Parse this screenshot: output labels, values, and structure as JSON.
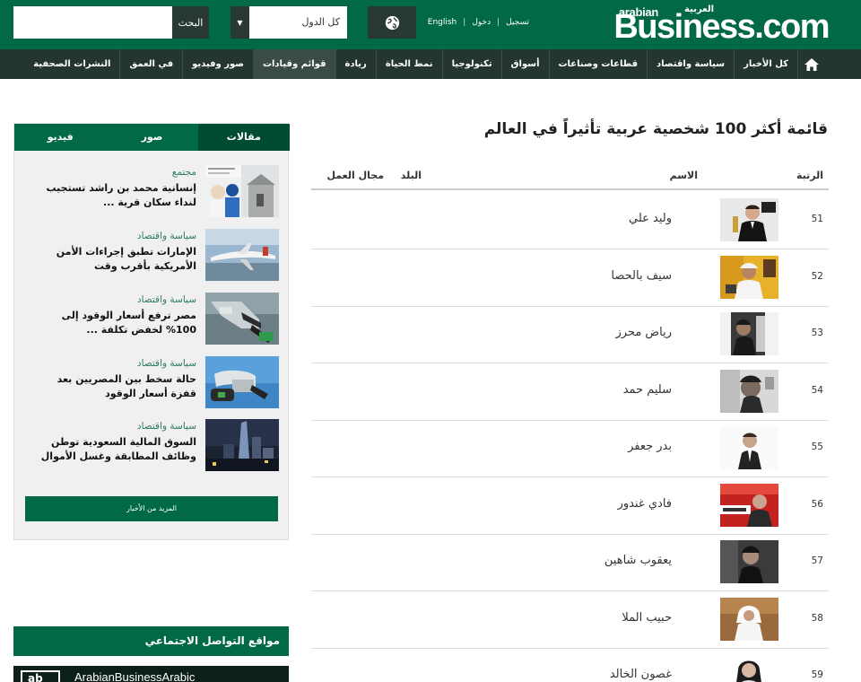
{
  "header": {
    "logo_latin": "arabian",
    "logo_arabic": "العربية",
    "logo_main": "Business.com",
    "links": {
      "english": "English",
      "login": "دخول",
      "register": "تسجيل"
    },
    "country_select": "كل الدول",
    "search_button": "البحث",
    "search_placeholder": ""
  },
  "nav": {
    "items": [
      "كل الأخبار",
      "سياسة واقتصاد",
      "قطاعات وصناعات",
      "أسواق",
      "تكنولوجيا",
      "نمط الحياة",
      "ريادة",
      "قوائم وقيادات",
      "صور وفيديو",
      "في العمق",
      "النشرات الصحفية"
    ]
  },
  "sidebar": {
    "tabs": [
      "مقالات",
      "صور",
      "فيديو"
    ],
    "news": [
      {
        "category": "مجتمع",
        "title": "إنسانية محمد بن راشد تستجيب لنداء سكان قرية ..."
      },
      {
        "category": "سياسة واقتصاد",
        "title": "الإمارات تطبق إجراءات الأمن الأمريكية بأقرب وقت"
      },
      {
        "category": "سياسة واقتصاد",
        "title": "مصر ترفع أسعار الوقود إلى 100% لخفض تكلفة ..."
      },
      {
        "category": "سياسة واقتصاد",
        "title": "حالة سخط بين المصريين بعد قفزة أسعار الوقود"
      },
      {
        "category": "سياسة واقتصاد",
        "title": "السوق المالية السعودية توطن وظائف المطابقة وغسل الأموال"
      }
    ],
    "more_button": "المزيد من الأخبار"
  },
  "social": {
    "heading": "مواقع التواصل الاجتماعي",
    "box": "ab",
    "account": "ArabianBusinessArabic"
  },
  "main": {
    "title": "قائمة أكثر 100 شخصية عربية تأثيراً في العالم",
    "columns": {
      "rank": "الرتبة",
      "name": "الاسم",
      "country": "البلد",
      "field": "مجال العمل"
    },
    "rows": [
      {
        "rank": "51",
        "name": "وليد علي"
      },
      {
        "rank": "52",
        "name": "سيف بالحصا"
      },
      {
        "rank": "53",
        "name": "رياض محرز"
      },
      {
        "rank": "54",
        "name": "سليم حمد"
      },
      {
        "rank": "55",
        "name": "بدر جعفر"
      },
      {
        "rank": "56",
        "name": "فادي غندور"
      },
      {
        "rank": "57",
        "name": "يعقوب شاهين"
      },
      {
        "rank": "58",
        "name": "حبيب الملا"
      },
      {
        "rank": "59",
        "name": "غصون الخالد"
      }
    ]
  },
  "colors": {
    "brand_green": "#016a44",
    "nav_dark": "#253532",
    "button_dark": "#283832"
  }
}
